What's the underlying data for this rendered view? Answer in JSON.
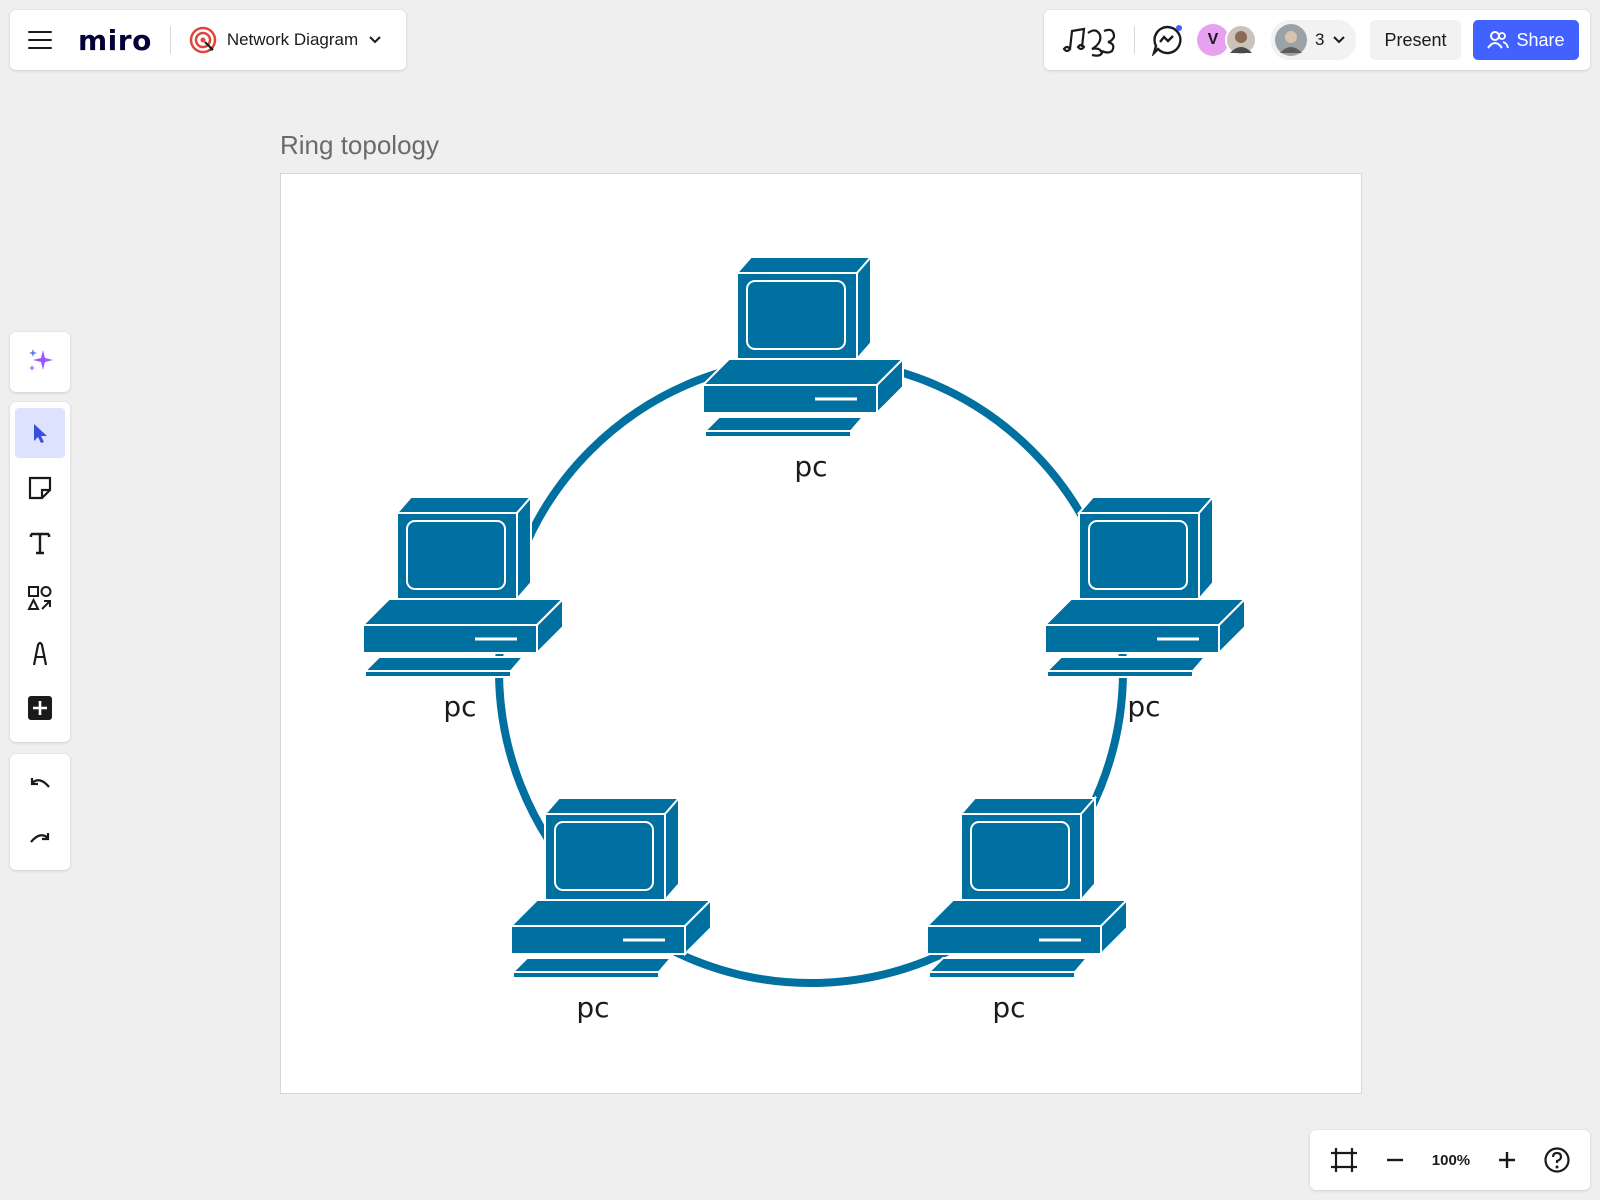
{
  "header": {
    "logo": "miro",
    "board_name": "Network Diagram",
    "collaborator_initial": "V",
    "collaborator_count": "3",
    "present_label": "Present",
    "share_label": "Share"
  },
  "canvas": {
    "frame_title": "Ring topology",
    "nodes": [
      {
        "label": "pc"
      },
      {
        "label": "pc"
      },
      {
        "label": "pc"
      },
      {
        "label": "pc"
      },
      {
        "label": "pc"
      }
    ],
    "diagram_color": "#0070a0"
  },
  "toolbar": {
    "icons": [
      "ai-sparkle-icon",
      "select-cursor-icon",
      "sticky-note-icon",
      "text-icon",
      "shapes-icon",
      "pen-icon",
      "add-icon",
      "undo-icon",
      "redo-icon"
    ]
  },
  "zoom": {
    "level": "100%"
  },
  "colors": {
    "accent": "#4262ff",
    "background": "#efefef"
  }
}
